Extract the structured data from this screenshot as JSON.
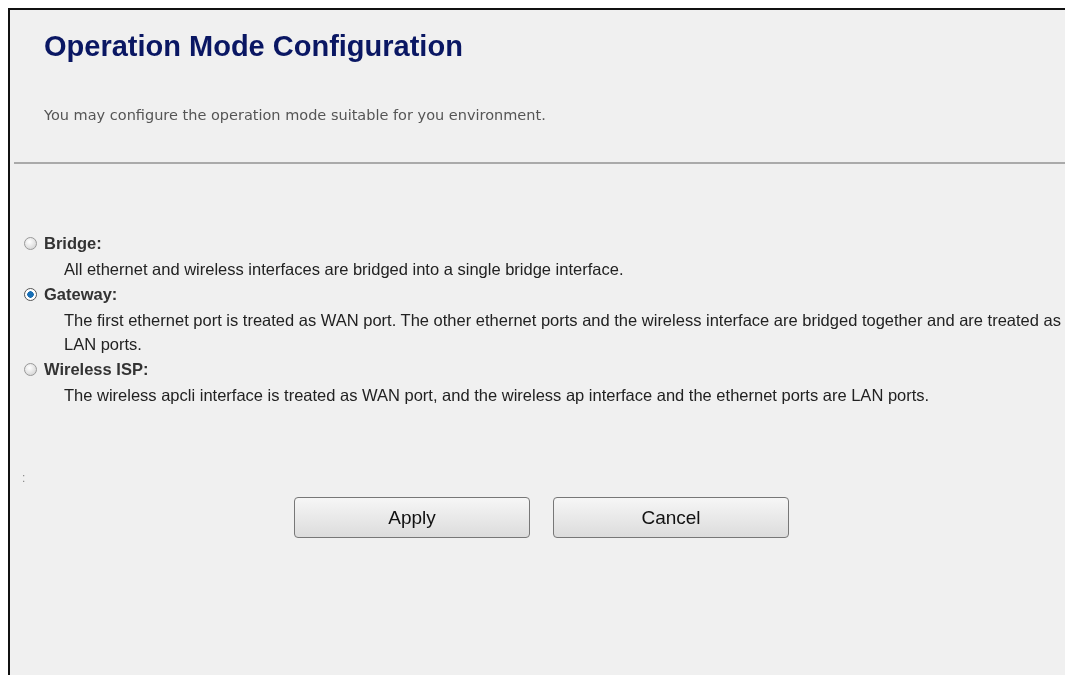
{
  "title": "Operation Mode Configuration",
  "description": "You may configure the operation mode suitable for you environment.",
  "modes": [
    {
      "label": "Bridge:",
      "description": "All ethernet and wireless interfaces are bridged into a single bridge interface.",
      "selected": false
    },
    {
      "label": "Gateway:",
      "description": "The first ethernet port is treated as WAN port. The other ethernet ports and the wireless interface are bridged together and are treated as LAN ports.",
      "selected": true
    },
    {
      "label": "Wireless ISP:",
      "description": "The wireless apcli interface is treated as WAN port, and the wireless ap interface and the ethernet ports are LAN ports.",
      "selected": false
    }
  ],
  "stray_text": ":",
  "buttons": [
    "Apply",
    "Cancel"
  ]
}
